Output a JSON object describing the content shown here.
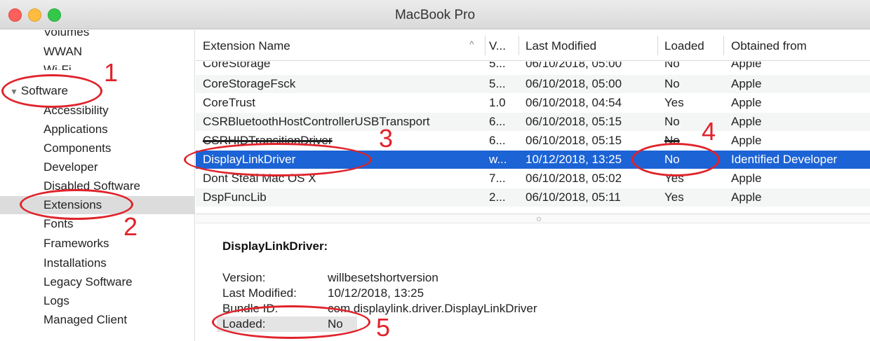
{
  "window": {
    "title": "MacBook Pro"
  },
  "sidebar": {
    "items_above": [
      "Volumes",
      "WWAN",
      "Wi-Fi"
    ],
    "group_label": "Software",
    "items": [
      "Accessibility",
      "Applications",
      "Components",
      "Developer",
      "Disabled Software",
      "Extensions",
      "Fonts",
      "Frameworks",
      "Installations",
      "Legacy Software",
      "Logs",
      "Managed Client"
    ],
    "selected": "Extensions"
  },
  "table": {
    "columns": [
      "Extension Name",
      "V...",
      "Last Modified",
      "Loaded",
      "Obtained from"
    ],
    "sort_indicator": "^",
    "rows": [
      {
        "name": "CoreStorage",
        "version": "5...",
        "modified": "06/10/2018, 05:00",
        "loaded": "No",
        "from": "Apple"
      },
      {
        "name": "CoreStorageFsck",
        "version": "5...",
        "modified": "06/10/2018, 05:00",
        "loaded": "No",
        "from": "Apple"
      },
      {
        "name": "CoreTrust",
        "version": "1.0",
        "modified": "06/10/2018, 04:54",
        "loaded": "Yes",
        "from": "Apple"
      },
      {
        "name": "CSRBluetoothHostControllerUSBTransport",
        "version": "6...",
        "modified": "06/10/2018, 05:15",
        "loaded": "No",
        "from": "Apple"
      },
      {
        "name": "CSRHIDTransitionDriver",
        "version": "6...",
        "modified": "06/10/2018, 05:15",
        "loaded": "No",
        "from": "Apple"
      },
      {
        "name": "DisplayLinkDriver",
        "version": "w...",
        "modified": "10/12/2018, 13:25",
        "loaded": "No",
        "from": "Identified Developer"
      },
      {
        "name": "Dont Steal Mac OS X",
        "version": "7...",
        "modified": "06/10/2018, 05:02",
        "loaded": "Yes",
        "from": "Apple"
      },
      {
        "name": "DspFuncLib",
        "version": "2...",
        "modified": "06/10/2018, 05:11",
        "loaded": "Yes",
        "from": "Apple"
      }
    ],
    "selected_row": 5
  },
  "detail": {
    "title": "DisplayLinkDriver:",
    "fields": [
      {
        "label": "Version:",
        "value": "willbesetshortversion"
      },
      {
        "label": "Last Modified:",
        "value": "10/12/2018, 13:25"
      },
      {
        "label": "Bundle ID:",
        "value": "com.displaylink.driver.DisplayLinkDriver"
      },
      {
        "label": "Loaded:",
        "value": "No"
      }
    ]
  },
  "annotations": {
    "color": "#e0232b",
    "numbers": [
      "1",
      "2",
      "3",
      "4",
      "5"
    ]
  },
  "colors": {
    "selection": "#1c63d5",
    "sidebar_selection": "#dcdcdc"
  }
}
